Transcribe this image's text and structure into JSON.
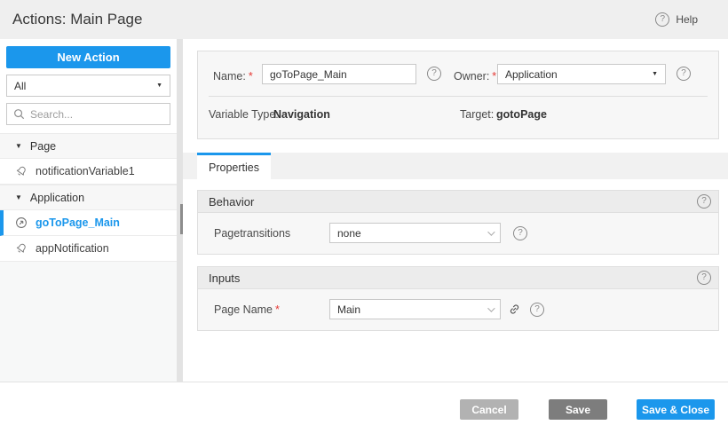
{
  "header": {
    "title": "Actions: Main Page",
    "help_label": "Help"
  },
  "sidebar": {
    "new_action_label": "New Action",
    "filter_value": "All",
    "search_placeholder": "Search...",
    "tree": [
      {
        "type": "group",
        "label": "Page"
      },
      {
        "type": "item",
        "label": "notificationVariable1",
        "icon": "bell-icon",
        "selected": false
      },
      {
        "type": "group",
        "label": "Application"
      },
      {
        "type": "item",
        "label": "goToPage_Main",
        "icon": "navigation-circle-icon",
        "selected": true
      },
      {
        "type": "item",
        "label": "appNotification",
        "icon": "bell-icon",
        "selected": false
      }
    ]
  },
  "form": {
    "required_mark": "*",
    "name_label": "Name:",
    "name_value": "goToPage_Main",
    "owner_label": "Owner:",
    "owner_value": "Application",
    "variable_type_label": "Variable Type:",
    "variable_type_value": "Navigation",
    "target_label": "Target:",
    "target_value": "gotoPage"
  },
  "tabs": [
    {
      "label": "Properties",
      "active": true
    }
  ],
  "sections": [
    {
      "title": "Behavior",
      "rows": [
        {
          "label": "Pagetransitions",
          "required": false,
          "value": "none"
        }
      ]
    },
    {
      "title": "Inputs",
      "rows": [
        {
          "label": "Page Name",
          "required": true,
          "value": "Main"
        }
      ]
    }
  ],
  "footer": {
    "cancel_label": "Cancel",
    "save_label": "Save",
    "save_close_label": "Save & Close"
  },
  "icons": {
    "question_glyph": "?",
    "dropdown_arrow": "▼",
    "tree_collapse_arrow": "▼"
  },
  "colors": {
    "accent_blue": "#1b97ec",
    "header_bg": "#efefef",
    "section_header_bg": "#ececec",
    "panel_bg": "#f7f7f7",
    "save_button_gray": "#7d7d7d",
    "cancel_button_gray": "#b2b2b2",
    "required_red": "#e53935"
  }
}
